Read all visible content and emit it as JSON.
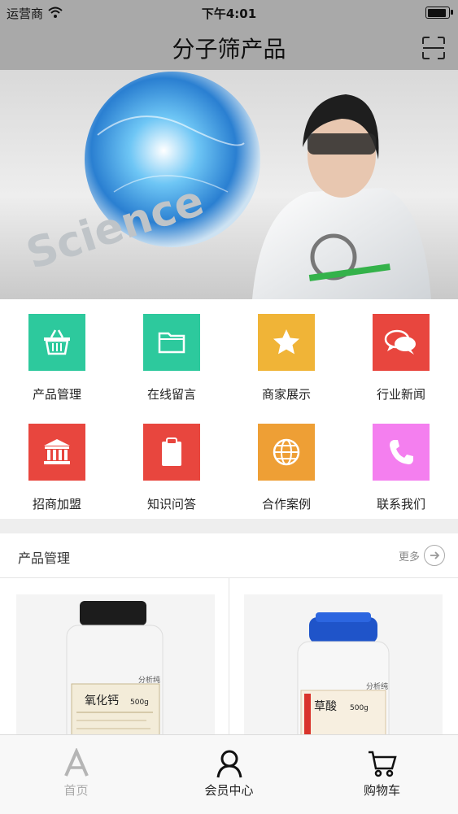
{
  "status_bar": {
    "carrier": "运营商",
    "time": "下午4:01"
  },
  "nav": {
    "title": "分子筛产品"
  },
  "banner": {
    "globe_text": "Science"
  },
  "menu": [
    {
      "label": "产品管理",
      "color": "#2dc99d",
      "icon": "basket-icon"
    },
    {
      "label": "在线留言",
      "color": "#2dc99d",
      "icon": "folder-icon"
    },
    {
      "label": "商家展示",
      "color": "#f0b437",
      "icon": "star-icon"
    },
    {
      "label": "行业新闻",
      "color": "#e8463e",
      "icon": "chat-bubbles-icon"
    },
    {
      "label": "招商加盟",
      "color": "#e8463e",
      "icon": "bank-icon"
    },
    {
      "label": "知识问答",
      "color": "#e8463e",
      "icon": "clipboard-icon"
    },
    {
      "label": "合作案例",
      "color": "#ee9f35",
      "icon": "globe-icon"
    },
    {
      "label": "联系我们",
      "color": "#f47fef",
      "icon": "phone-icon"
    }
  ],
  "section": {
    "title": "产品管理",
    "more": "更多"
  },
  "products": [
    {
      "top_label": "分析纯",
      "name": "氧化钙",
      "weight": "500g"
    },
    {
      "top_label": "分析纯",
      "name": "草酸",
      "weight": "500g"
    }
  ],
  "tabbar": [
    {
      "label": "首页",
      "icon": "home-a-icon",
      "active": true
    },
    {
      "label": "会员中心",
      "icon": "user-icon",
      "active": false
    },
    {
      "label": "购物车",
      "icon": "cart-icon",
      "active": false
    }
  ]
}
